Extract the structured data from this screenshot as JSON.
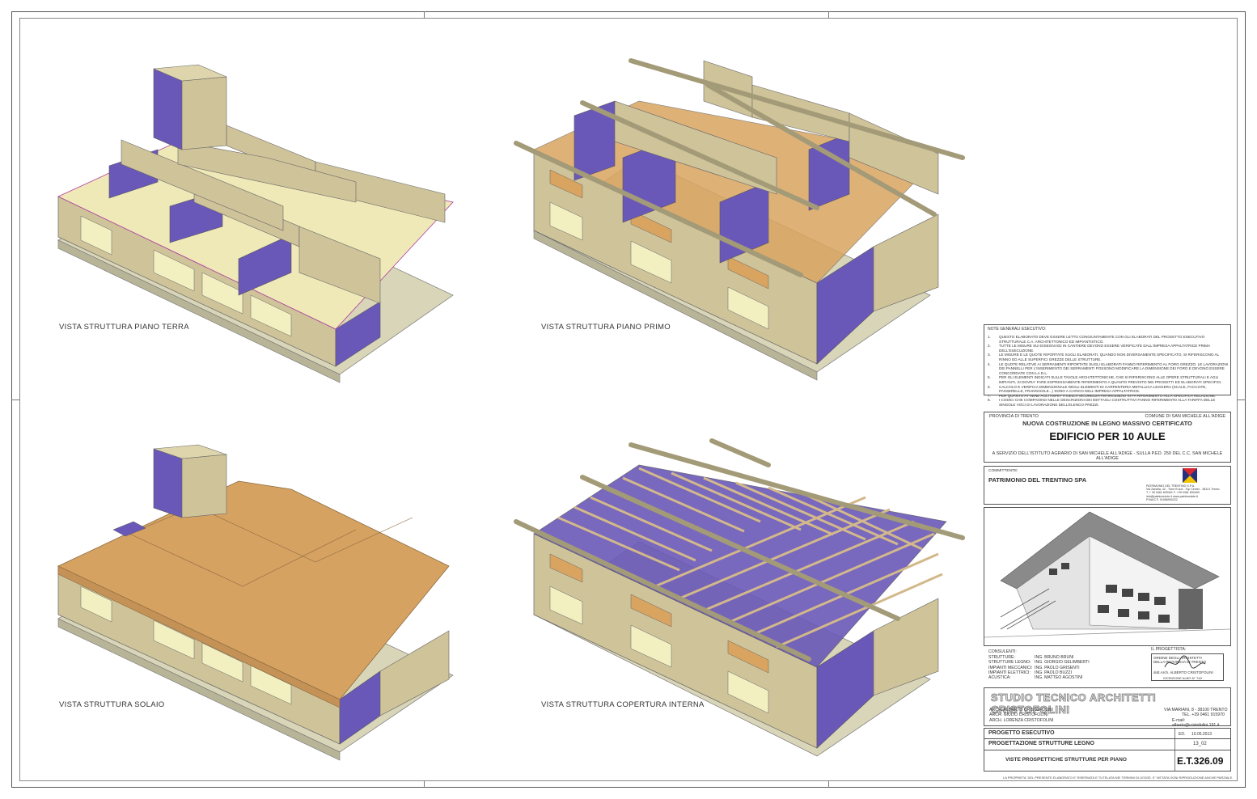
{
  "views": [
    {
      "caption": "VISTA STRUTTURA PIANO TERRA"
    },
    {
      "caption": "VISTA STRUTTURA PIANO PRIMO"
    },
    {
      "caption": "VISTA STRUTTURA SOLAIO"
    },
    {
      "caption": "VISTA STRUTTURA COPERTURA INTERNA"
    }
  ],
  "notes": {
    "title": "NOTE GENERALI ESECUTIVO:",
    "items": [
      {
        "n": "1.",
        "text": "QUESTO ELABORATO DEVE ESSERE LETTO CONGIUNTAMENTE CON GLI ELABORATI DEL PROGETTO ESECUTIVO STRUTTURALE C.A. ARCHITETTONICO ED IMPIANTISTICO."
      },
      {
        "n": "2.",
        "text": "TUTTE LE MISURE SUI DISEGNI ED IN CANTIERE DEVONO ESSERE VERIFICATE DALL'IMPRESA APPALTATRICE PRIMA DELL'ESECUZIONE."
      },
      {
        "n": "3.",
        "text": "LE MISURE E LE QUOTE RIPORTATE SUGLI ELABORATI, QUANDO NON DIVERSAMENTE SPECIFICATO, SI RIFERISCONO AL RINNO ED ALLE SUPERFICI GREZZE DELLE STRUTTURE."
      },
      {
        "n": "4.",
        "text": "LE QUOTE RELATIVE AI SERRAMENTI RIPORTATE SUGLI ELABORATI FANNO RIFERIMENTO AL FORO GREZZO. LE LAVORAZIONI DEI PANNELLI PER L'INSERIMENTO DEI SERRAMENTI POSSONO MODIFICARE LA DIMENSIONE DEI FORO E DEVONO ESSERE CONCORDATE CON LA D.L."
      },
      {
        "n": "5.",
        "text": "PER GLI ELEMENTI INDICATI SULLE TAVOLE ARCHITETTONICHE, CHE SI RIFERISCONO ALLE OPERE STRUTTURALI E AGLI IMPIANTI, SI DOVRA' FARE ESPRESSAMENTE RIFERIMENTO A QUANTO PREVISTO NEI PROGETTI ED ELABORATI SPECIFICI."
      },
      {
        "n": "6.",
        "text": "CALCOLO E VERIFICA DIMENSIONALE DEGLI ELEMENTI DI CARPENTERIA METALLICA LEGGERA (SCALE, FACCIATE, PASSERELLE, FRANGISOLE...) SONO A CARICO DELL'IMPRESA APPALTATRICE."
      },
      {
        "n": "7.",
        "text": "PER QUANTO ATTIENE AGLI ASPETTI DELLA SICUREZZA ANTINCENDIO SI FA RIFERIMENTO ALLA SPECIFICA RELAZIONE."
      },
      {
        "n": "8.",
        "text": "I CODICI CHE COMPAIONO NELLE DESCRIZIONI DEI DETTAGLI COSTRUTTIVI FANNO RIFERIMENTO ALLA TARIFFA DELLE SINGOLE VOCI DI LAVORAZIONE DELL'ELENCO PREZZI."
      }
    ]
  },
  "project": {
    "province": "PROVINCIA DI TRENTO",
    "comune": "COMUNE DI SAN MICHELE ALL'ADIGE",
    "subtitle": "NUOVA COSTRUZIONE IN LEGNO MASSIVO CERTIFICATO",
    "title": "EDIFICIO PER 10 AULE",
    "service": "A SERVIZIO DELL'ISTITUTO AGRARIO DI SAN MICHELE ALL'ADIGE - SULLA P.ED. 250 DEL C.C. SAN MICHELE ALL'ADIGE"
  },
  "client": {
    "label": "COMMITTENTE:",
    "name": "PATRIMONIO DEL TRENTINO SPA",
    "company": "PATRIMONIO DEL TRENTINO S.P.A.",
    "address": "Via Zanella, 42 - Torre B sud - Top Center - 38121 Trento",
    "phone": "T. + 39 0461 830401  F. +39 0461 830499",
    "email": "info@patrimoniotn.it  www.patrimoniotn.it",
    "piva": "P.IVA/C.F. 01956900222",
    "logo_colors": {
      "red": "#d9282f",
      "blue": "#27327f",
      "yellow": "#f2c500"
    }
  },
  "consultants": {
    "label": "CONSULENTI:",
    "rows": [
      {
        "role": "STRUTTURE:",
        "name": "ING. BRUNO BRUNI"
      },
      {
        "role": "STRUTTURE LEGNO:",
        "name": "ING. GIORGIO GELIMBERTI"
      },
      {
        "role": "IMPIANTI MECCANICI:",
        "name": "ING. PAOLO GRISENTI"
      },
      {
        "role": "IMPIANTI ELETTRICI:",
        "name": "ING. PAOLO BUZZI"
      },
      {
        "role": "ACUSTICA:",
        "name": "ING. MATTEO AGOSTINI"
      }
    ]
  },
  "designer": {
    "label": "IL PROGETTISTA:",
    "stamp_line1": "ORDINE DEGLI ARCHITETTI",
    "stamp_line2": "DELLA PROVINCIA DI TRENTO",
    "stamp_name": "dott.Arch. ALBERTO CRISTOFOLINI",
    "stamp_reg": "ISCRIZIONE ALBO N° 749"
  },
  "studio": {
    "name": "STUDIO TECNICO ARCHITETTI CRISTOFOLINI",
    "architects": [
      "ARCH. ALBERTO CRISTOFOLINI",
      "ARCH. GIULIO CRISTOFOLINI",
      "ARCH. LORENZA CRISTOFOLINI"
    ],
    "address": "VIA MARIANI, 8 - 38100 TRENTO",
    "tel": "TEL. +39 0461 915970",
    "email": "E-mail: alberto@cristofolini.191.it"
  },
  "phase": {
    "label": "PROGETTO ESECUTIVO",
    "ed_label": "ED.",
    "date": "10.05.2013",
    "discipline": "PROGETTAZIONE STRUTTURE LEGNO",
    "job": "13_02",
    "sheet_title": "VISTE PROSPETTICHE STRUTTURE PER PIANO",
    "code": "E.T.326.09"
  },
  "footer": "LA PROPRIETA' DEL PRESENTE ELABORATO E' RISERVATA E TUTELATA NEI TERMINI DI LEGGE. E' VIETATA OGNI RIPRODUZIONE ANCHE PARZIALE."
}
